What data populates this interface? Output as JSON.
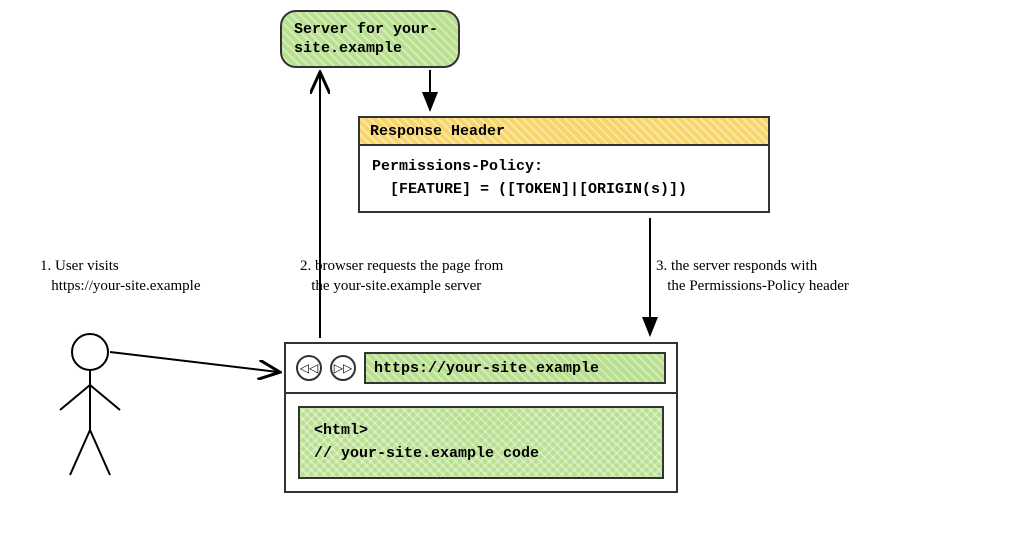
{
  "server": {
    "label": "Server for\nyour-site.example"
  },
  "response": {
    "header_label": "Response Header",
    "body": "Permissions-Policy:\n  [FEATURE] = ([TOKEN]|[ORIGIN(s)])"
  },
  "captions": {
    "step1": "1. User visits\n   https://your-site.example",
    "step2": "2. browser requests the page from\n   the your-site.example server",
    "step3": "3. the server responds with\n   the Permissions-Policy header"
  },
  "browser": {
    "back_glyph": "◁◁",
    "forward_glyph": "▷▷",
    "address": "https://your-site.example",
    "code": "<html>\n// your-site.example code"
  }
}
